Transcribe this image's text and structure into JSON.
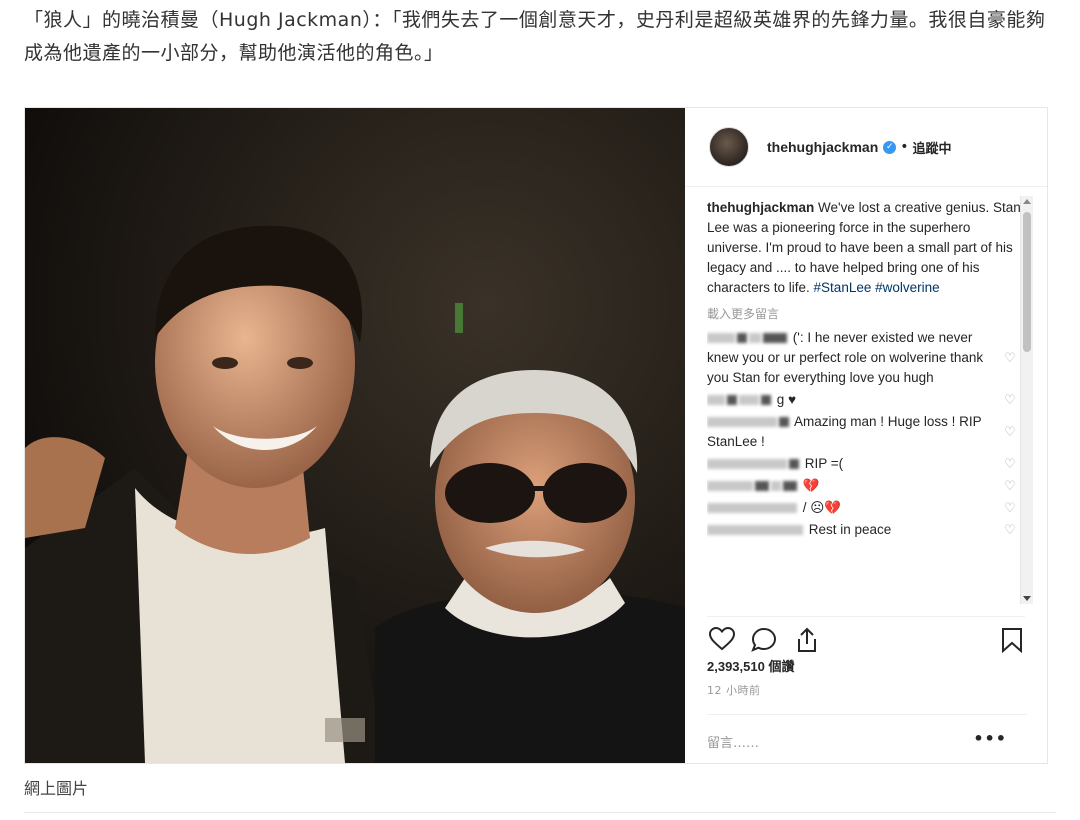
{
  "quote": {
    "text": "「狼人」的曉治積曼（Hugh Jackman）：「我們失去了一個創意天才，史丹利是超級英雄界的先鋒力量。我很自豪能夠成為他遺產的一小部分，幫助他演活他的角色。」"
  },
  "post": {
    "username": "thehughjackman",
    "separator": "•",
    "follow_status": "追蹤中",
    "caption_user": "thehughjackman",
    "caption_text": " We've lost a creative genius. Stan Lee was a pioneering force in the superhero universe. I'm proud to have been a small part of his legacy and .... to have helped bring one of his characters to life. ",
    "caption_tags": "#StanLee #wolverine",
    "load_more": "載入更多留言",
    "comments": [
      {
        "text": "(': I he never existed we never knew you or ur perfect role on wolverine thank you Stan for everything love you hugh"
      },
      {
        "text": "g ♥"
      },
      {
        "text": "Amazing man ! Huge loss ! RIP StanLee !"
      },
      {
        "text": "RIP =("
      },
      {
        "text": "💔"
      },
      {
        "text": "/ ☹💔"
      },
      {
        "text": "Rest in peace"
      }
    ],
    "likes": "2,393,510 個讚",
    "time_ago": "12 小時前",
    "comment_placeholder": "留言……",
    "more": "•••",
    "icons": {
      "heart": "heart-outline-icon",
      "comment": "comment-bubble-icon",
      "share": "share-upload-icon",
      "bookmark": "bookmark-icon",
      "verified": "verified-badge-icon"
    }
  },
  "image_caption": "網上圖片"
}
